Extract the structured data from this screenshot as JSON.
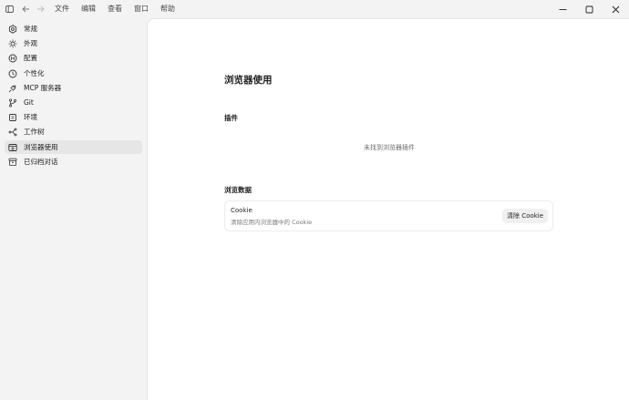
{
  "menu": [
    "文件",
    "编辑",
    "查看",
    "窗口",
    "帮助"
  ],
  "sidebar": {
    "items": [
      {
        "label": "常规",
        "icon": "settings-gear-icon",
        "active": false
      },
      {
        "label": "外观",
        "icon": "sun-icon",
        "active": false
      },
      {
        "label": "配置",
        "icon": "config-icon",
        "active": false
      },
      {
        "label": "个性化",
        "icon": "clock-icon",
        "active": false
      },
      {
        "label": "MCP 服务器",
        "icon": "plug-icon",
        "active": false
      },
      {
        "label": "Git",
        "icon": "git-branch-icon",
        "active": false
      },
      {
        "label": "环境",
        "icon": "cloud-icon",
        "active": false
      },
      {
        "label": "工作树",
        "icon": "worktree-icon",
        "active": false
      },
      {
        "label": "浏览器使用",
        "icon": "browser-icon",
        "active": true
      },
      {
        "label": "已归档对话",
        "icon": "archive-icon",
        "active": false
      }
    ]
  },
  "main": {
    "title": "浏览器使用",
    "plugins_section": "插件",
    "plugins_empty": "未找到浏览器插件",
    "data_section": "浏览数据",
    "cookie_card": {
      "title": "Cookie",
      "description": "清除应用内浏览器中的 Cookie",
      "button": "清除 Cookie"
    }
  }
}
